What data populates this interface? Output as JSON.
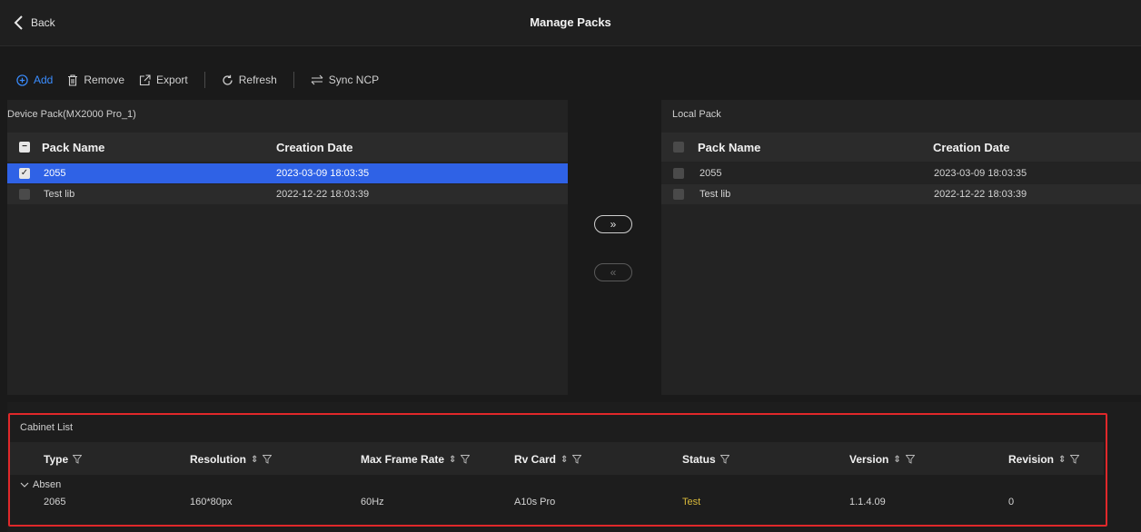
{
  "header": {
    "back_label": "Back",
    "title": "Manage Packs"
  },
  "toolbar": {
    "add": "Add",
    "remove": "Remove",
    "export": "Export",
    "refresh": "Refresh",
    "sync": "Sync NCP"
  },
  "device_pack": {
    "title": "Device Pack(MX2000 Pro_1)",
    "col_name": "Pack Name",
    "col_date": "Creation Date",
    "rows": [
      {
        "name": "2055",
        "date": "2023-03-09 18:03:35",
        "checked": true
      },
      {
        "name": "Test lib",
        "date": "2022-12-22 18:03:39",
        "checked": false
      }
    ]
  },
  "local_pack": {
    "title": "Local Pack",
    "col_name": "Pack Name",
    "col_date": "Creation Date",
    "rows": [
      {
        "name": "2055",
        "date": "2023-03-09 18:03:35",
        "checked": false
      },
      {
        "name": "Test lib",
        "date": "2022-12-22 18:03:39",
        "checked": false
      }
    ]
  },
  "transfer": {
    "to_local": "»",
    "to_device": "«"
  },
  "cabinet": {
    "title": "Cabinet List",
    "columns": {
      "type": "Type",
      "resolution": "Resolution",
      "frame_rate": "Max Frame Rate",
      "rv_card": "Rv Card",
      "status": "Status",
      "version": "Version",
      "revision": "Revision"
    },
    "group": "Absen",
    "row": {
      "type": "2065",
      "resolution": "160*80px",
      "frame_rate": "60Hz",
      "rv_card": "A10s Pro",
      "status": "Test",
      "version": "1.1.4.09",
      "revision": "0"
    },
    "status_color": "#d8b93a",
    "highlight_color": "#e0282a"
  },
  "colors": {
    "accent": "#3a8dff",
    "selection": "#2f62e6"
  }
}
